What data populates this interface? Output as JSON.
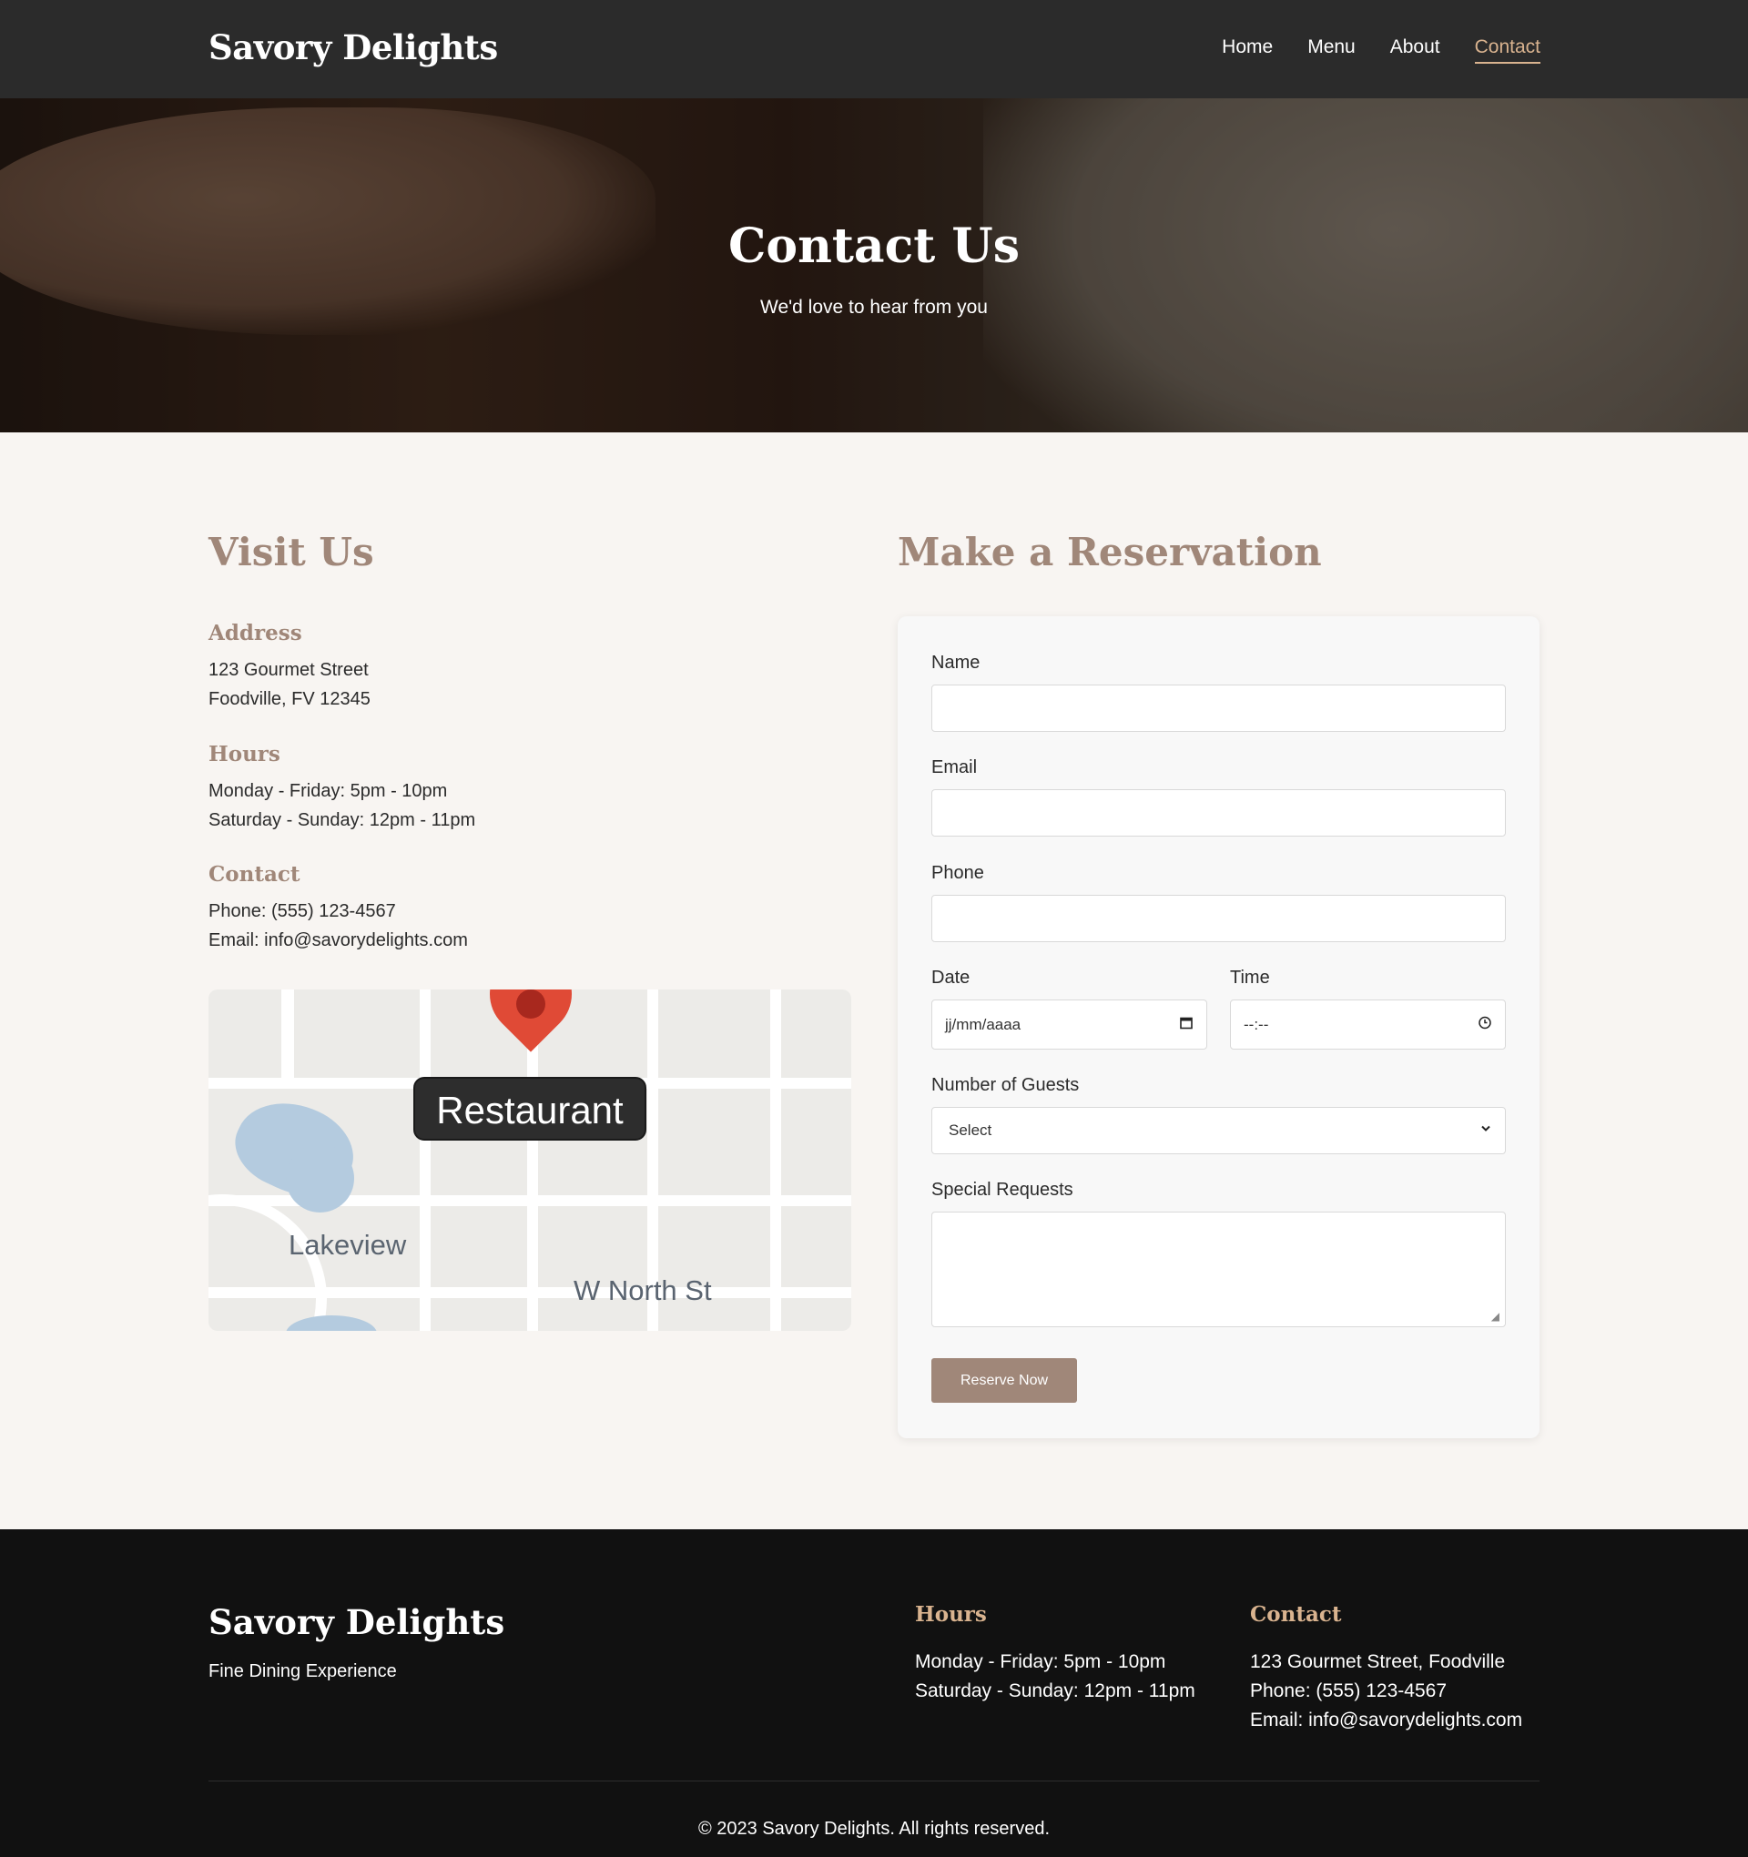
{
  "nav": {
    "brand": "Savory Delights",
    "links": [
      "Home",
      "Menu",
      "About",
      "Contact"
    ],
    "active": "Contact"
  },
  "hero": {
    "title": "Contact Us",
    "subtitle": "We'd love to hear from you"
  },
  "visit": {
    "title": "Visit Us",
    "address_heading": "Address",
    "address_lines": [
      "123 Gourmet Street",
      "Foodville, FV 12345"
    ],
    "hours_heading": "Hours",
    "hours_lines": [
      "Monday - Friday: 5pm - 10pm",
      "Saturday - Sunday: 12pm - 11pm"
    ],
    "contact_heading": "Contact",
    "contact_lines": [
      "Phone: (555) 123-4567",
      "Email: info@savorydelights.com"
    ]
  },
  "map": {
    "pin_label": "Restaurant",
    "area_label": "Lakeview",
    "street_label": "W North St"
  },
  "reservation": {
    "title": "Make a Reservation",
    "name_label": "Name",
    "email_label": "Email",
    "phone_label": "Phone",
    "date_label": "Date",
    "date_placeholder": "jj/mm/aaaa",
    "time_label": "Time",
    "time_placeholder": "--:--",
    "guests_label": "Number of Guests",
    "guests_value": "Select",
    "requests_label": "Special Requests",
    "submit_label": "Reserve Now"
  },
  "footer": {
    "brand": "Savory Delights",
    "tagline": "Fine Dining Experience",
    "hours_heading": "Hours",
    "hours_lines": [
      "Monday - Friday: 5pm - 10pm",
      "Saturday - Sunday: 12pm - 11pm"
    ],
    "contact_heading": "Contact",
    "contact_lines": [
      "123 Gourmet Street, Foodville",
      "Phone: (555) 123-4567",
      "Email: info@savorydelights.com"
    ],
    "copyright": "© 2023 Savory Delights. All rights reserved."
  },
  "colors": {
    "accent": "#a08779",
    "footer_accent": "#d9b38f",
    "nav_bg": "#2b2b2b",
    "page_bg": "#f8f5f2",
    "pin": "#e04a36"
  },
  "icons": {
    "date": "calendar-icon",
    "time": "clock-icon",
    "select": "chevron-down-icon",
    "map": "map-pin-icon"
  }
}
